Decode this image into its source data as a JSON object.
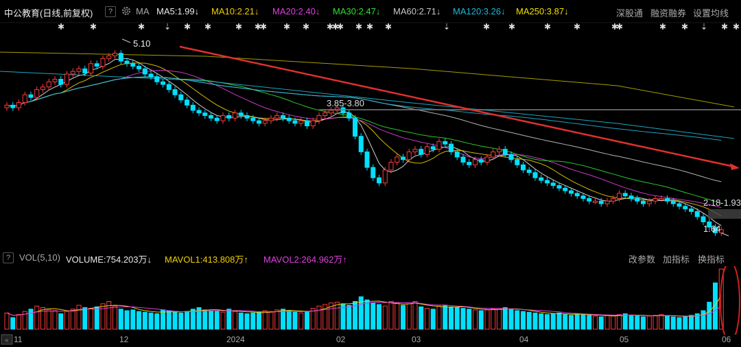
{
  "header": {
    "stock_name": "中公教育",
    "period": "(日线,前复权)",
    "help": "?",
    "ma_tag": "MA",
    "ma_labels": [
      {
        "text": "MA5:1.99",
        "arrow": "↓",
        "color": "#e8e8e8"
      },
      {
        "text": "MA10:2.21",
        "arrow": "↓",
        "color": "#f0d000"
      },
      {
        "text": "MA20:2.40",
        "arrow": "↓",
        "color": "#e040e0"
      },
      {
        "text": "MA30:2.47",
        "arrow": "↓",
        "color": "#30e030"
      },
      {
        "text": "MA60:2.71",
        "arrow": "↓",
        "color": "#c8c8c8"
      },
      {
        "text": "MA120:3.26",
        "arrow": "↓",
        "color": "#20b8d8"
      },
      {
        "text": "MA250:3.87",
        "arrow": "↓",
        "color": "#f0e000"
      }
    ],
    "actions": [
      "深股通",
      "融资融券",
      "设置均线"
    ]
  },
  "volume_header": {
    "help": "?",
    "indicator": "VOL(5,10)",
    "volume": "VOLUME:754.203万",
    "volume_arrow": "↓",
    "mavol1": "MAVOL1:413.808万",
    "mavol1_arrow": "↑",
    "mavol2": "MAVOL2:264.962万",
    "mavol2_arrow": "↑",
    "actions": [
      "改参数",
      "加指标",
      "换指标"
    ]
  },
  "colors": {
    "up": "#ff3c3c",
    "down": "#00e0ff",
    "ma5": "#e8e8e8",
    "ma10": "#f0d000",
    "ma20": "#e040e0",
    "ma30": "#30e030",
    "ma60": "#c8c8c8",
    "ma120": "#20b8d8",
    "ma250": "#f0e000",
    "trend": "#e03030",
    "resistance": "#777777"
  },
  "chart_data": {
    "type": "candlestick",
    "x_tick_labels": [
      "11",
      "12",
      "2024",
      "02",
      "03",
      "04",
      "05",
      "06"
    ],
    "price_annotations": {
      "high": "5.10",
      "zone1": "3.85-3.80",
      "zone2": "2.18-1.93",
      "low": "1.64"
    },
    "closes": [
      4.1,
      4.05,
      4.15,
      4.3,
      4.25,
      4.4,
      4.45,
      4.55,
      4.6,
      4.5,
      4.7,
      4.75,
      4.8,
      4.72,
      4.9,
      4.85,
      5.0,
      5.05,
      5.1,
      4.95,
      4.9,
      4.85,
      4.8,
      4.7,
      4.65,
      4.55,
      4.5,
      4.4,
      4.3,
      4.2,
      4.1,
      4.0,
      3.95,
      3.9,
      3.85,
      3.8,
      3.9,
      3.85,
      3.95,
      3.9,
      3.85,
      3.8,
      3.75,
      3.8,
      3.85,
      3.9,
      3.85,
      3.8,
      3.75,
      3.8,
      3.7,
      3.8,
      3.9,
      3.95,
      4.0,
      4.05,
      3.95,
      3.85,
      3.5,
      3.2,
      2.9,
      2.7,
      2.6,
      2.85,
      3.0,
      3.1,
      3.05,
      3.2,
      3.25,
      3.15,
      3.3,
      3.25,
      3.4,
      3.35,
      3.2,
      3.1,
      3.0,
      2.95,
      3.05,
      3.0,
      3.1,
      3.2,
      3.25,
      3.15,
      3.05,
      2.95,
      2.85,
      2.8,
      2.7,
      2.65,
      2.6,
      2.55,
      2.5,
      2.45,
      2.4,
      2.35,
      2.3,
      2.25,
      2.25,
      2.2,
      2.25,
      2.3,
      2.4,
      2.35,
      2.3,
      2.25,
      2.2,
      2.25,
      2.3,
      2.3,
      2.25,
      2.2,
      2.15,
      2.1,
      2.05,
      1.95,
      1.85,
      1.75,
      1.64,
      1.7
    ],
    "volumes": [
      210,
      150,
      190,
      230,
      260,
      300,
      280,
      250,
      240,
      200,
      230,
      260,
      310,
      280,
      270,
      290,
      330,
      360,
      300,
      260,
      240,
      250,
      230,
      220,
      210,
      200,
      250,
      240,
      220,
      210,
      230,
      260,
      280,
      250,
      240,
      230,
      220,
      260,
      230,
      210,
      200,
      210,
      220,
      240,
      230,
      250,
      260,
      240,
      220,
      210,
      230,
      270,
      300,
      320,
      340,
      350,
      330,
      310,
      360,
      420,
      380,
      340,
      320,
      300,
      360,
      340,
      310,
      330,
      360,
      290,
      270,
      260,
      300,
      310,
      290,
      280,
      270,
      260,
      250,
      240,
      250,
      260,
      270,
      280,
      260,
      240,
      230,
      220,
      210,
      200,
      190,
      200,
      210,
      190,
      180,
      200,
      190,
      180,
      170,
      160,
      180,
      170,
      190,
      200,
      180,
      170,
      160,
      170,
      180,
      190,
      170,
      160,
      150,
      170,
      180,
      200,
      240,
      350,
      600,
      780
    ]
  }
}
